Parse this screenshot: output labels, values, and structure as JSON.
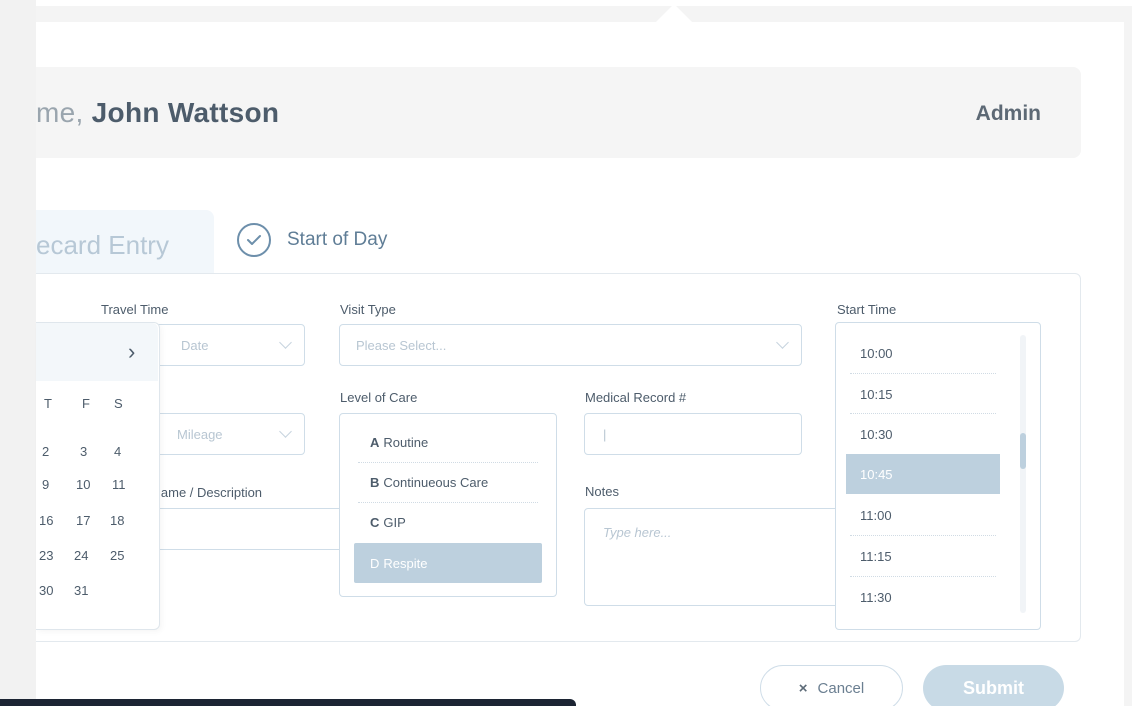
{
  "header": {
    "greeting_prefix": "me,",
    "user_name": "John Wattson",
    "role": "Admin"
  },
  "tabs": {
    "active_label": "ecard Entry",
    "start_of_day_label": "Start of Day"
  },
  "form": {
    "travel_time_label": "Travel Time",
    "date_placeholder": "Date",
    "mileage_placeholder": "Mileage",
    "name_description_label": "lame / Description",
    "visit_type_label": "Visit Type",
    "visit_type_placeholder": "Please Select...",
    "level_of_care_label": "Level of Care",
    "level_of_care_options": [
      {
        "letter": "A",
        "label": "Routine",
        "selected": false
      },
      {
        "letter": "B",
        "label": "Continueous Care",
        "selected": false
      },
      {
        "letter": "C",
        "label": "GIP",
        "selected": false
      },
      {
        "letter": "D",
        "label": "Respite",
        "selected": true
      }
    ],
    "medical_record_label": "Medical Record #",
    "medical_record_value": "|",
    "notes_label": "Notes",
    "notes_placeholder": "Type here...",
    "start_time_label": "Start Time",
    "start_time_options": [
      "10:00",
      "10:15",
      "10:30",
      "10:45",
      "11:00",
      "11:15",
      "11:30"
    ],
    "start_time_selected": "10:45",
    "start_time_scroll_fraction": 0.36
  },
  "calendar": {
    "next_glyph": "›",
    "weekday_headers": [
      "T",
      "F",
      "S"
    ],
    "weeks": [
      [
        "2",
        "3",
        "4"
      ],
      [
        "9",
        "10",
        "11"
      ],
      [
        "16",
        "17",
        "18"
      ],
      [
        "23",
        "24",
        "25"
      ],
      [
        "30",
        "31",
        ""
      ]
    ]
  },
  "actions": {
    "cancel_icon": "×",
    "cancel_label": "Cancel",
    "submit_label": "Submit"
  },
  "colors": {
    "accent": "#5f7d96",
    "selected_bg": "#bdd0de",
    "submit_bg": "#c8dae6"
  }
}
